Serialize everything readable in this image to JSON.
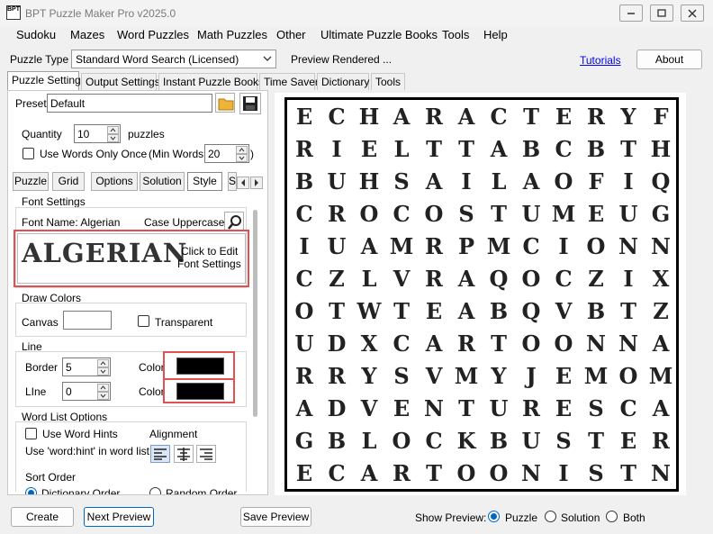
{
  "window": {
    "title": "BPT Puzzle Maker Pro v2025.0",
    "app_icon_text": "BPT"
  },
  "menu": [
    "Sudoku",
    "Mazes",
    "Word Puzzles",
    "Math Puzzles",
    "Other",
    "Ultimate Puzzle Books",
    "Tools",
    "Help"
  ],
  "toolbar": {
    "puzzle_type_label": "Puzzle Type",
    "puzzle_type_value": "Standard Word Search (Licensed)",
    "status": "Preview Rendered ...",
    "tutorials": "Tutorials",
    "about": "About"
  },
  "tabs": [
    "Puzzle Settings",
    "Output Settings",
    "Instant Puzzle Books",
    "Time Saver",
    "Dictionary",
    "Tools"
  ],
  "settings": {
    "preset_label": "Preset",
    "preset_value": "Default",
    "quantity_label": "Quantity",
    "quantity_value": "10",
    "quantity_suffix": "puzzles",
    "use_words_once": "Use Words Only Once",
    "min_words_label": "(Min Words:",
    "min_words_value": "20",
    "min_words_close": ")"
  },
  "subtabs": [
    "Puzzle",
    "Grid",
    "Options",
    "Solution",
    "Style",
    "S"
  ],
  "style": {
    "font_settings_title": "Font Settings",
    "font_name_label": "Font Name: Algerian",
    "case_label": "Case Uppercase",
    "font_sample": "ALGERIAN",
    "click_edit_line1": "Click to Edit",
    "click_edit_line2": "Font Settings",
    "draw_colors_title": "Draw Colors",
    "canvas_label": "Canvas",
    "transparent_label": "Transparent",
    "line_title": "Line",
    "border_label": "Border",
    "border_value": "5",
    "line_label": "LIne",
    "line_value": "0",
    "color_label": "Color",
    "color_label2": "Color",
    "border_color": "#000000",
    "line_color": "#000000",
    "word_list_title": "Word List Options",
    "use_word_hints": "Use Word Hints",
    "word_hint_label": "Use 'word:hint' in word list",
    "alignment_label": "Alignment",
    "sort_order_label": "Sort Order",
    "sort_option1": "Dictionary Order",
    "sort_option2": "Random Order"
  },
  "puzzle_grid": [
    "ECHARACTERYF",
    "RIELTTABCBTH",
    "BUHSAILAOFIQ",
    "CROCOSTUMEUG",
    "IUAMRPMCIONN",
    "CZLVRAQOCZIX",
    "OTWTEABQVBTZ",
    "UDXCARTOONNA",
    "RRYSVMYJEMOM",
    "ADVENTURESCA",
    "GBLOCKBUSTER",
    "ECARTOONISTN"
  ],
  "bottom": {
    "create": "Create",
    "next_preview": "Next Preview",
    "save_preview": "Save Preview",
    "show_preview_label": "Show Preview:",
    "opt_puzzle": "Puzzle",
    "opt_solution": "Solution",
    "opt_both": "Both",
    "selected": "Puzzle"
  }
}
